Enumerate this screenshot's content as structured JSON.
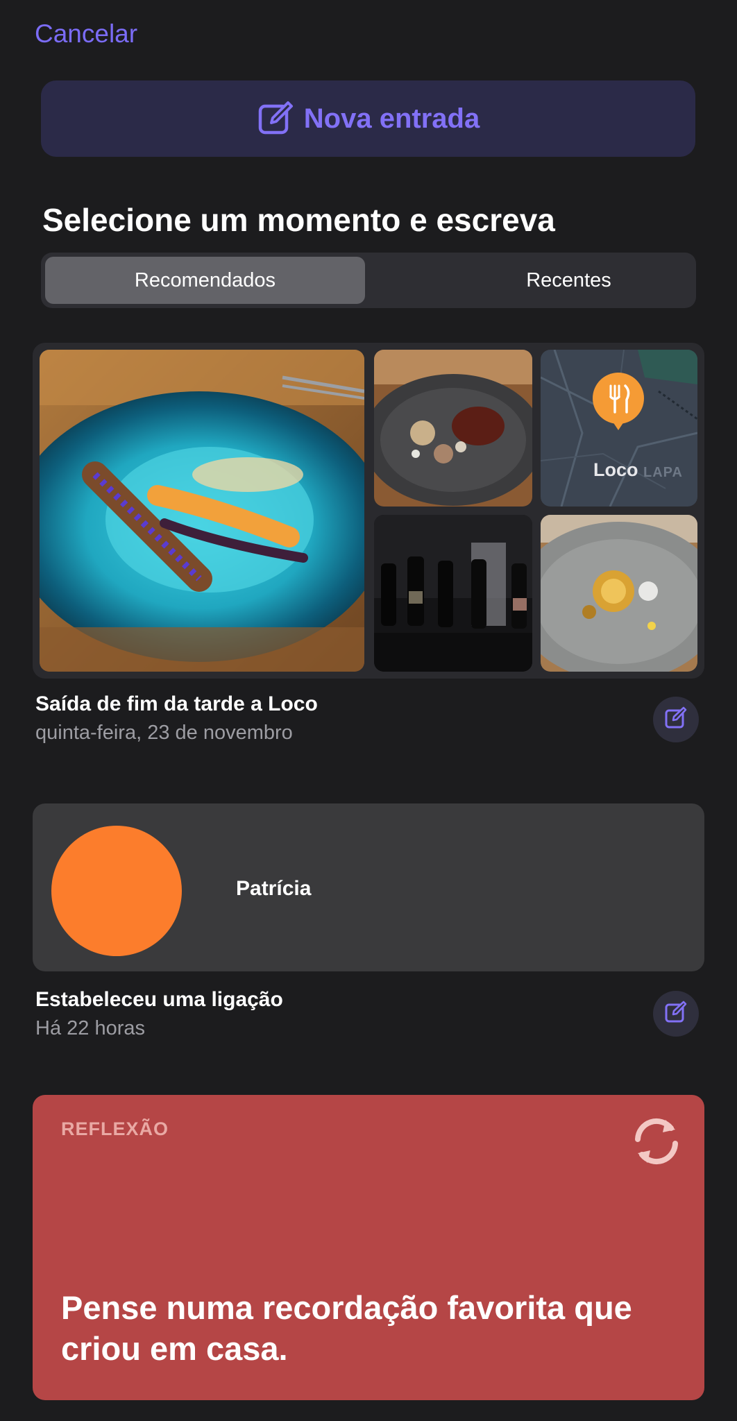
{
  "nav": {
    "cancel_label": "Cancelar"
  },
  "new_entry": {
    "label": "Nova entrada",
    "icon": "compose-icon"
  },
  "section_title": "Selecione um momento e escreva",
  "tabs": [
    {
      "label": "Recomendados",
      "selected": true
    },
    {
      "label": "Recentes",
      "selected": false
    }
  ],
  "moments": [
    {
      "title": "Saída de fim da tarde a Loco",
      "subtitle": "quinta-feira, 23 de novembro",
      "map_place": "Loco",
      "map_area": "LAPA",
      "map_pin_icon": "fork-knife-icon"
    },
    {
      "contact_name": "Patrícia",
      "title": "Estabeleceu uma ligação",
      "subtitle": "Há 22 horas"
    }
  ],
  "reflection": {
    "label": "REFLEXÃO",
    "text": "Pense numa recordação favorita que criou em casa.",
    "refresh_icon": "refresh-icon"
  },
  "colors": {
    "accent": "#7b6cf6",
    "background": "#1c1c1e",
    "avatar": "#fc7d2c",
    "reflection_bg": "#b54646"
  }
}
